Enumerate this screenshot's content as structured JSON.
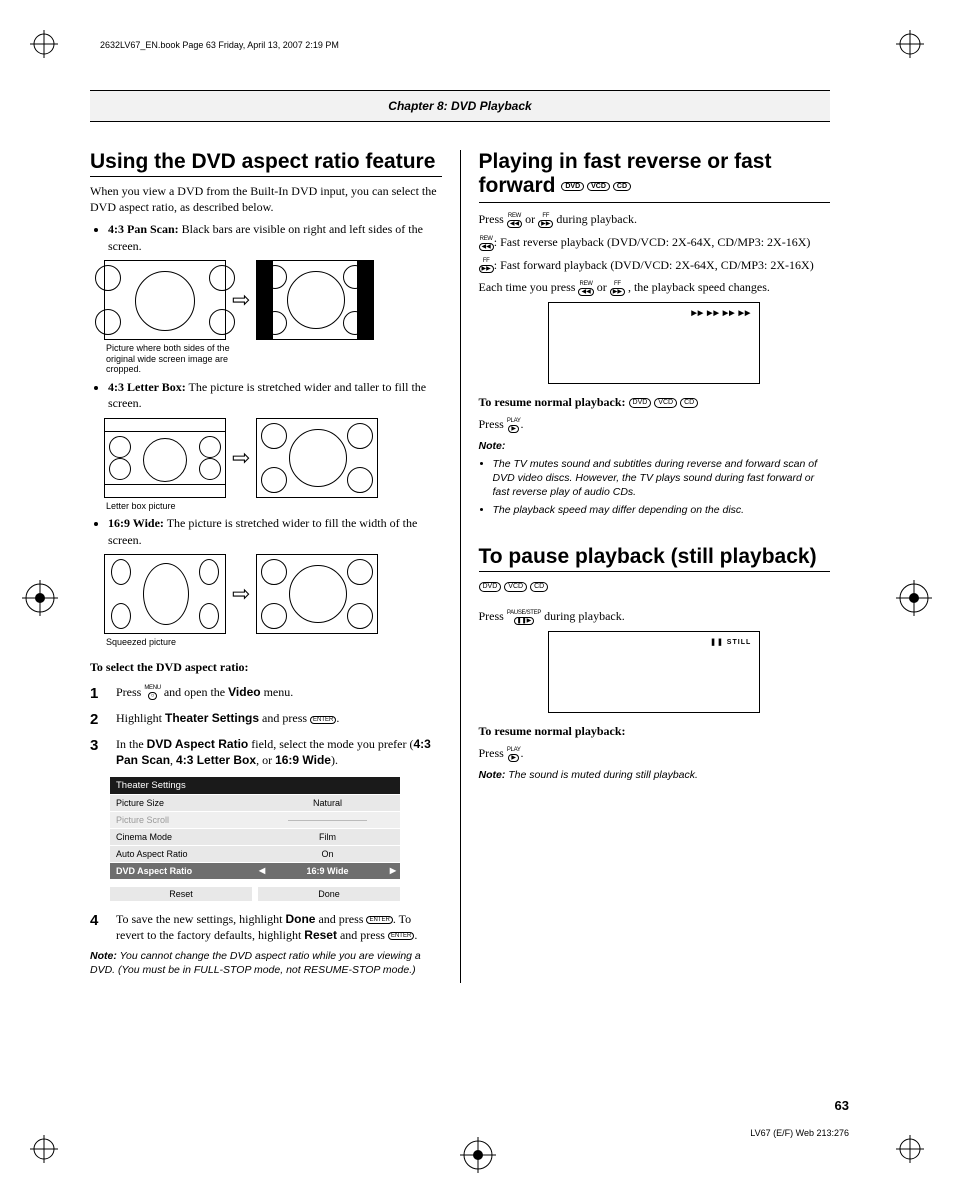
{
  "header": {
    "bookline": "2632LV67_EN.book  Page 63  Friday, April 13, 2007  2:19 PM",
    "chapter": "Chapter 8: DVD Playback"
  },
  "left": {
    "h1": "Using the DVD aspect ratio feature",
    "intro": "When you view a DVD from the Built-In DVD input, you can select the DVD aspect ratio, as described below.",
    "bul1_label": "4:3 Pan Scan:",
    "bul1_text": " Black bars are visible on right and left sides of the screen.",
    "cap1": "Picture where both sides of the original wide screen image are cropped.",
    "bul2_label": "4:3 Letter Box:",
    "bul2_text": " The picture is stretched wider and taller to fill the screen.",
    "cap2": "Letter box picture",
    "bul3_label": "16:9 Wide:",
    "bul3_text": " The picture is stretched wider to fill the width of the screen.",
    "cap3": "Squeezed picture",
    "select_hd": "To select the DVD aspect ratio:",
    "step1_a": "Press ",
    "step1_b": " and open the ",
    "step1_c": "Video",
    "step1_d": " menu.",
    "step2_a": "Highlight ",
    "step2_b": "Theater Settings",
    "step2_c": " and press ",
    "step3_a": "In the ",
    "step3_b": "DVD Aspect Ratio",
    "step3_c": " field, select the mode you prefer (",
    "step3_d": "4:3 Pan Scan",
    "step3_e": ", ",
    "step3_f": "4:3 Letter Box",
    "step3_g": ", or ",
    "step3_h": "16:9 Wide",
    "step3_i": ").",
    "menu": {
      "title": "Theater Settings",
      "rows": [
        {
          "label": "Picture Size",
          "value": "Natural"
        },
        {
          "label": "Picture Scroll",
          "value": ""
        },
        {
          "label": "Cinema Mode",
          "value": "Film"
        },
        {
          "label": "Auto Aspect Ratio",
          "value": "On"
        },
        {
          "label": "DVD Aspect Ratio",
          "value": "16:9 Wide"
        }
      ],
      "reset": "Reset",
      "done": "Done"
    },
    "step4_a": "To save the new settings, highlight ",
    "step4_b": "Done",
    "step4_c": " and press ",
    "step4_d": ". To revert to the factory defaults, highlight ",
    "step4_e": "Reset",
    "step4_f": " and press ",
    "note_lbl": "Note:",
    "note_txt": " You cannot change the DVD aspect ratio while you are viewing a DVD. (You must be in FULL-STOP mode, not RESUME-STOP mode.)"
  },
  "right": {
    "h1": "Playing in fast reverse or fast forward",
    "badges": [
      "DVD",
      "VCD",
      "CD"
    ],
    "p1a": "Press ",
    "p1b": " or ",
    "p1c": " during playback.",
    "p2": ": Fast reverse playback (DVD/VCD: 2X-64X, CD/MP3: 2X-16X)",
    "p3": ": Fast forward playback (DVD/VCD: 2X-64X, CD/MP3: 2X-16X)",
    "p4a": "Each time you press ",
    "p4b": "  or  ",
    "p4c": " , the playback speed changes.",
    "tv1_osd": "▶▶ ▶▶ ▶▶ ▶▶",
    "resume_hd": "To resume normal playback:",
    "resume_txt": "Press ",
    "note_hd": "Note:",
    "notes": [
      "The TV mutes sound and subtitles during reverse and forward scan of DVD video discs. However, the TV plays sound during fast forward or fast reverse play of audio CDs.",
      "The playback speed may differ depending on the disc."
    ],
    "h2": "To pause playback (still playback)",
    "p5a": "Press ",
    "p5b": " during playback.",
    "tv2_osd": "❚❚  STILL",
    "resume2_hd": "To resume normal playback:",
    "resume2_txt": "Press ",
    "note2_lbl": "Note:",
    "note2_txt": " The sound is muted during still playback."
  },
  "icons": {
    "menu": {
      "lbl": "MENU",
      "sym": "○"
    },
    "enter": {
      "sym": "ENTER"
    },
    "rew": {
      "lbl": "REW",
      "sym": "◀◀"
    },
    "ff": {
      "lbl": "FF",
      "sym": "▶▶"
    },
    "play": {
      "lbl": "PLAY",
      "sym": "▶"
    },
    "pause": {
      "lbl": "PAUSE/STEP",
      "sym": "❚❚▶"
    }
  },
  "footer": {
    "pagenum": "63",
    "foot": "LV67 (E/F) Web 213:276"
  }
}
